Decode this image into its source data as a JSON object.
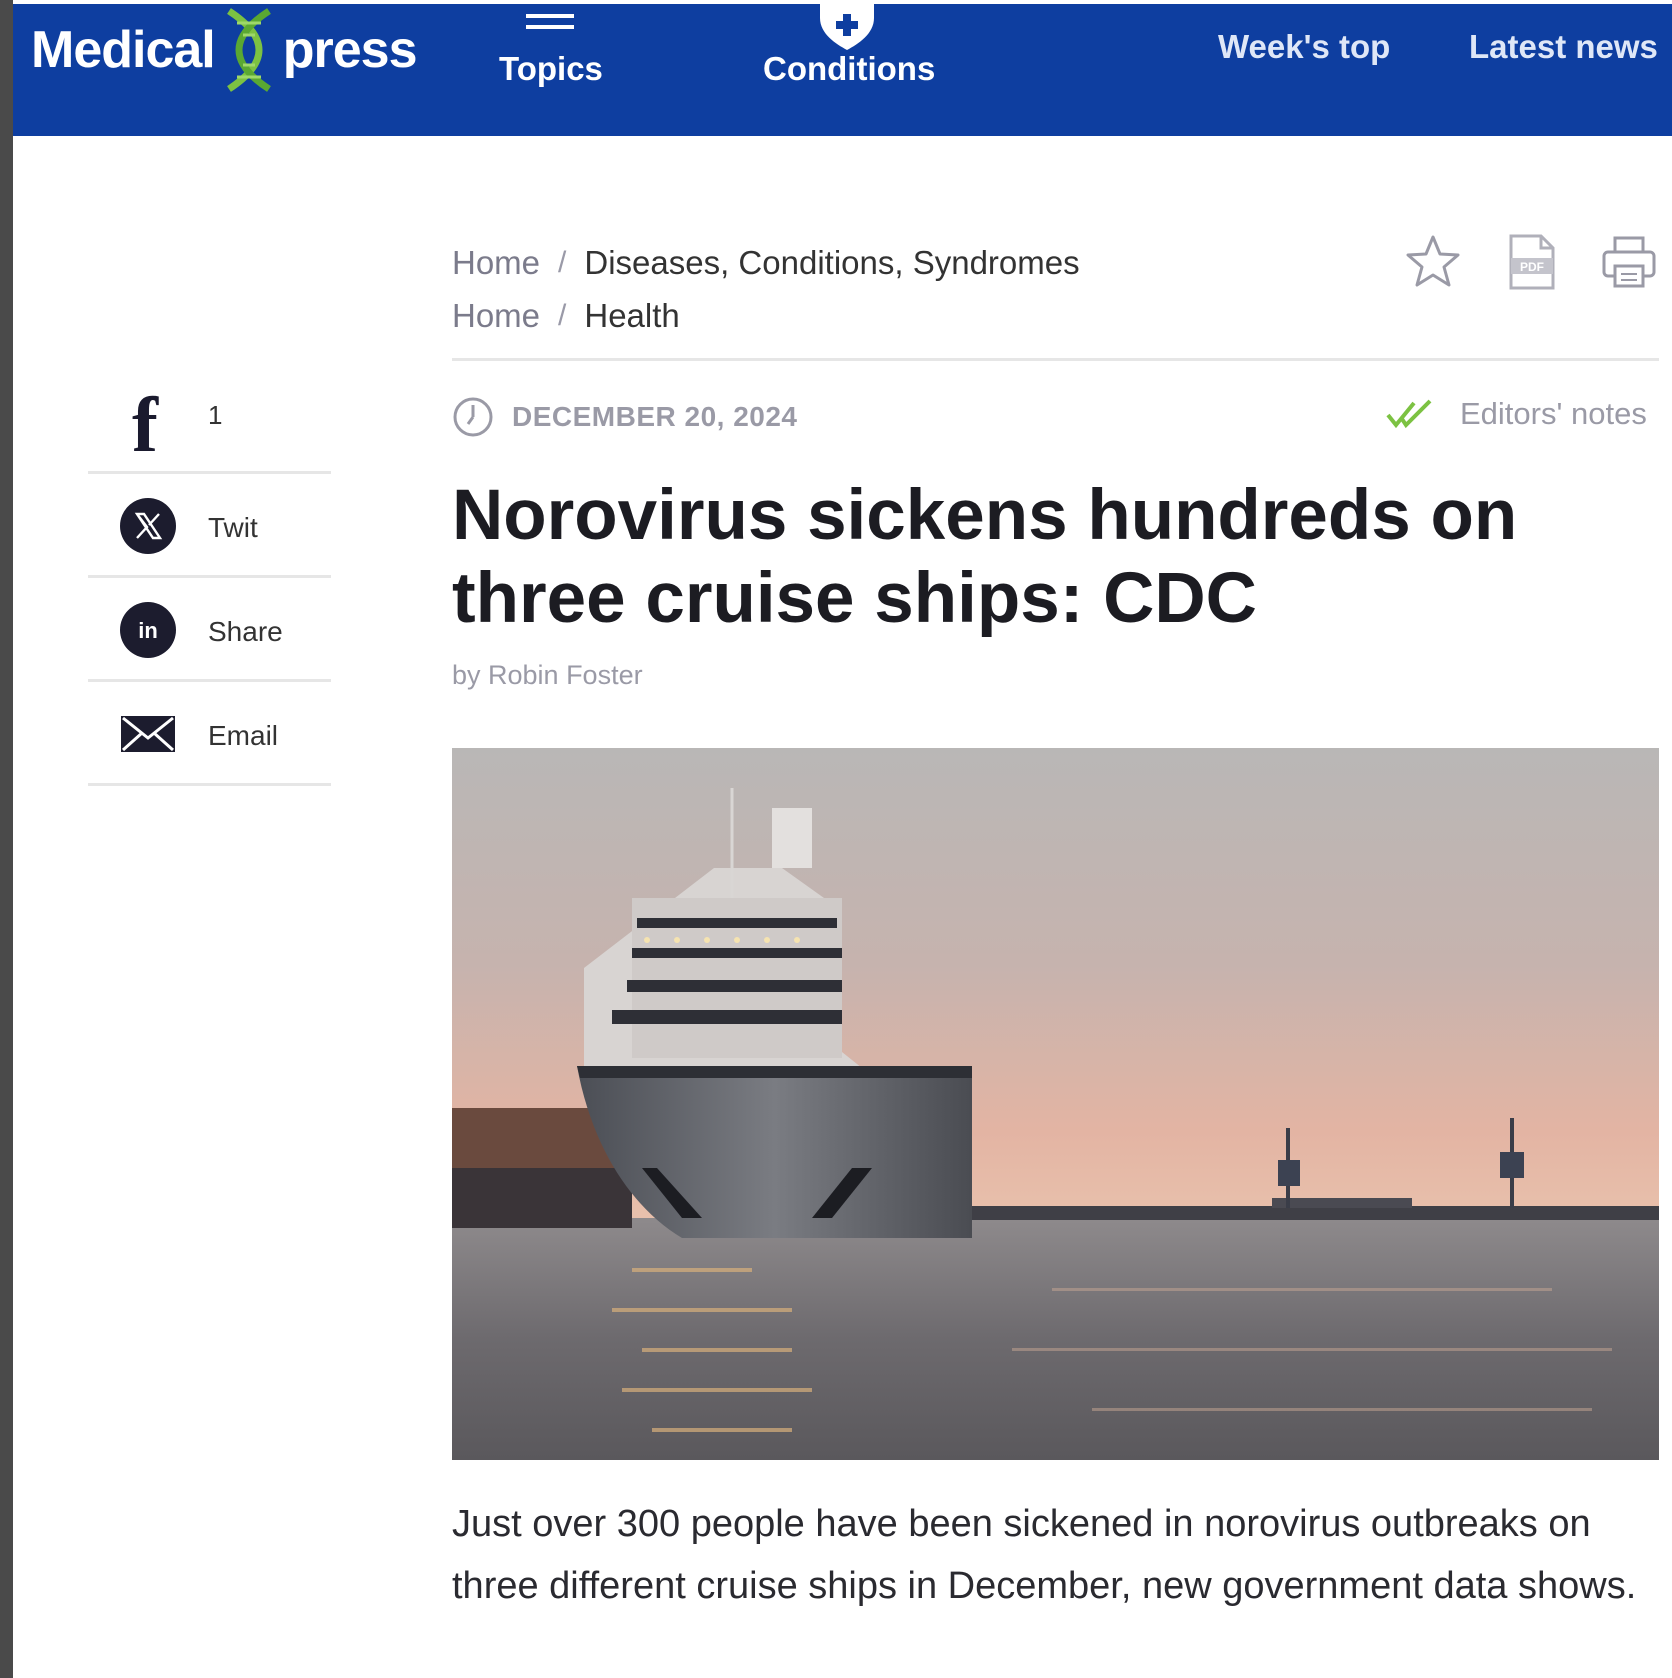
{
  "header": {
    "logo_left": "Medical",
    "logo_right": "press",
    "nav": {
      "topics": "Topics",
      "conditions": "Conditions",
      "weeks_top": "Week's top",
      "latest_news": "Latest news"
    },
    "brand_color": "#0e3ea0"
  },
  "social": {
    "facebook_count": "1",
    "twitter_label": "Twit",
    "linkedin_label": "Share",
    "email_label": "Email"
  },
  "breadcrumbs": [
    {
      "home": "Home",
      "category": "Diseases, Conditions, Syndromes"
    },
    {
      "home": "Home",
      "category": "Health"
    }
  ],
  "tools": {
    "icons": [
      "star-icon",
      "pdf-icon",
      "print-icon"
    ],
    "pdf_text": "PDF"
  },
  "article": {
    "date": "DECEMBER 20, 2024",
    "editors_notes": "Editors' notes",
    "title": "Norovirus sickens hundreds on three cruise ships: CDC",
    "byline": "by Robin Foster",
    "lead": "Just over 300 people have been sickened in norovirus outbreaks on three different cruise ships in December, new government data shows.",
    "editors_check_color": "#7cc242"
  }
}
